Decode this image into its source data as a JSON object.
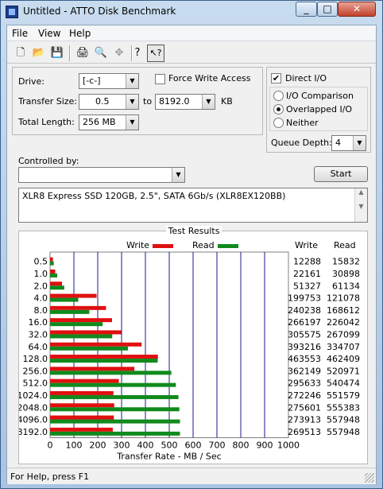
{
  "window": {
    "title": "Untitled - ATTO Disk Benchmark",
    "min_label": "_",
    "max_label": "□",
    "close_label": "✕"
  },
  "menu": [
    {
      "label": "File"
    },
    {
      "label": "View"
    },
    {
      "label": "Help"
    }
  ],
  "toolbar": [
    {
      "name": "new-icon",
      "glyph": "🗋"
    },
    {
      "name": "open-icon",
      "glyph": "📂"
    },
    {
      "name": "save-icon",
      "glyph": "💾"
    },
    {
      "name": "print-icon",
      "glyph": "🖨"
    },
    {
      "name": "print-preview-icon",
      "glyph": "🔍"
    },
    {
      "name": "move-icon",
      "glyph": "✥"
    },
    {
      "name": "about-icon",
      "glyph": "?"
    },
    {
      "name": "context-help-icon",
      "glyph": "↖?"
    }
  ],
  "settings": {
    "drive_label": "Drive:",
    "drive_value": "[-c-]",
    "force_write_label": "Force Write Access",
    "direct_io_label": "Direct I/O",
    "direct_io_checked": true,
    "transfer_size_label": "Transfer Size:",
    "transfer_from": "0.5",
    "to_label": "to",
    "transfer_to": "8192.0",
    "kb_label": "KB",
    "total_length_label": "Total Length:",
    "total_length_value": "256 MB",
    "io_comparison_label": "I/O Comparison",
    "overlapped_io_label": "Overlapped I/O",
    "neither_label": "Neither",
    "queue_depth_label": "Queue Depth:",
    "queue_depth_value": "4",
    "controlled_by_label": "Controlled by:",
    "controlled_by_value": "",
    "start_label": "Start",
    "description": "XLR8 Express SSD 120GB, 2.5\", SATA 6Gb/s (XLR8EX120BB)"
  },
  "results": {
    "title": "Test Results",
    "legend_write": "Write",
    "legend_read": "Read",
    "col_write": "Write",
    "col_read": "Read",
    "write_color": "#e01010",
    "read_color": "#108a1c",
    "grid_color": "#1a1a8c"
  },
  "chart_data": {
    "type": "bar",
    "categories": [
      "0.5",
      "1.0",
      "2.0",
      "4.0",
      "8.0",
      "16.0",
      "32.0",
      "64.0",
      "128.0",
      "256.0",
      "512.0",
      "1024.0",
      "2048.0",
      "4096.0",
      "8192.0"
    ],
    "series": [
      {
        "name": "Write",
        "values": [
          12288,
          22161,
          51327,
          199753,
          240238,
          266197,
          305575,
          393216,
          463553,
          362149,
          295633,
          272246,
          275601,
          273913,
          269513
        ]
      },
      {
        "name": "Read",
        "values": [
          15832,
          30898,
          61134,
          121078,
          168612,
          226042,
          267099,
          334707,
          462409,
          520971,
          540474,
          551579,
          555383,
          557948,
          557948
        ]
      }
    ],
    "xlabel": "Transfer Rate - MB / Sec",
    "xlim": [
      0,
      1000
    ],
    "xticks": [
      0,
      100,
      200,
      300,
      400,
      500,
      600,
      700,
      800,
      900,
      1000
    ],
    "grid": true,
    "legend": "top"
  },
  "status": {
    "text": "For Help, press F1"
  }
}
